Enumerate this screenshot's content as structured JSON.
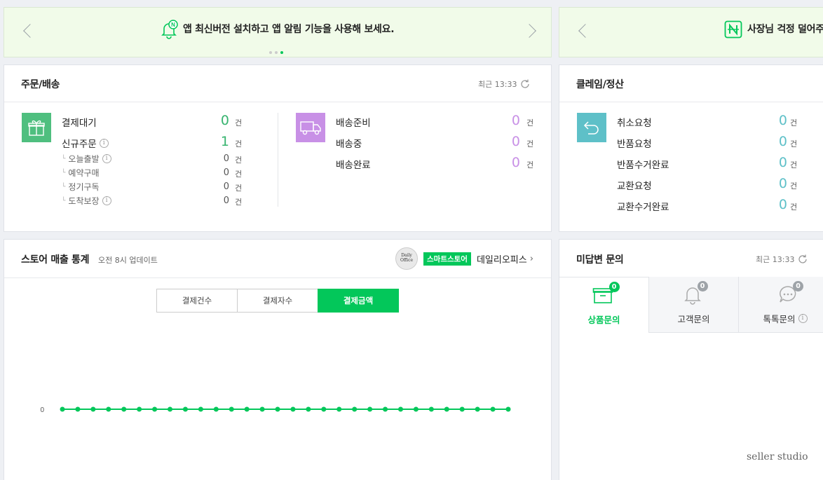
{
  "banner1": {
    "text": "앱 최신버전 설치하고 앱 알림 기능을 사용해 보세요."
  },
  "banner2": {
    "text": "사장님 걱정 덜어주"
  },
  "orders": {
    "title": "주문/배송",
    "recent": "최근 13:33",
    "unit": "건",
    "payment_wait": {
      "label": "결제대기",
      "count": "0"
    },
    "new_order": {
      "label": "신규주문",
      "count": "1"
    },
    "sub": [
      {
        "label": "오늘출발",
        "count": "0"
      },
      {
        "label": "예약구매",
        "count": "0"
      },
      {
        "label": "정기구독",
        "count": "0"
      },
      {
        "label": "도착보장",
        "count": "0"
      }
    ],
    "shipping": [
      {
        "label": "배송준비",
        "count": "0"
      },
      {
        "label": "배송중",
        "count": "0"
      },
      {
        "label": "배송완료",
        "count": "0"
      }
    ]
  },
  "claims": {
    "title": "클레임/정산",
    "unit": "건",
    "items": [
      {
        "label": "취소요청",
        "count": "0"
      },
      {
        "label": "반품요청",
        "count": "0"
      },
      {
        "label": "반품수거완료",
        "count": "0"
      },
      {
        "label": "교환요청",
        "count": "0"
      },
      {
        "label": "교환수거완료",
        "count": "0"
      }
    ]
  },
  "stats": {
    "title": "스토어 매출 통계",
    "updated": "오전 8시 업데이트",
    "store_badge": "스마트스토어",
    "store_name": "데일리오피스",
    "logo_text_1": "Daily",
    "logo_text_2": "Office",
    "tabs": [
      "결제건수",
      "결제자수",
      "결제금액"
    ],
    "active_tab": 2
  },
  "chart_data": {
    "type": "line",
    "series": [
      {
        "values": [
          0,
          0,
          0,
          0,
          0,
          0,
          0,
          0,
          0,
          0,
          0,
          0,
          0,
          0,
          0,
          0,
          0,
          0,
          0,
          0,
          0,
          0,
          0,
          0,
          0,
          0,
          0,
          0,
          0,
          0
        ]
      }
    ],
    "y_tick_labels": [
      "0"
    ],
    "line_color": "#03c75a"
  },
  "inquiries": {
    "title": "미답변 문의",
    "recent": "최근 13:33",
    "tabs": [
      {
        "label": "상품문의",
        "count": "0"
      },
      {
        "label": "고객문의",
        "count": "0"
      },
      {
        "label": "톡톡문의",
        "count": "0"
      }
    ]
  },
  "watermark": "seller studio",
  "colors": {
    "accent": "#03c75a",
    "purple": "#c890e6",
    "teal": "#5ec0c8",
    "green_tile": "#4fbf7f"
  }
}
